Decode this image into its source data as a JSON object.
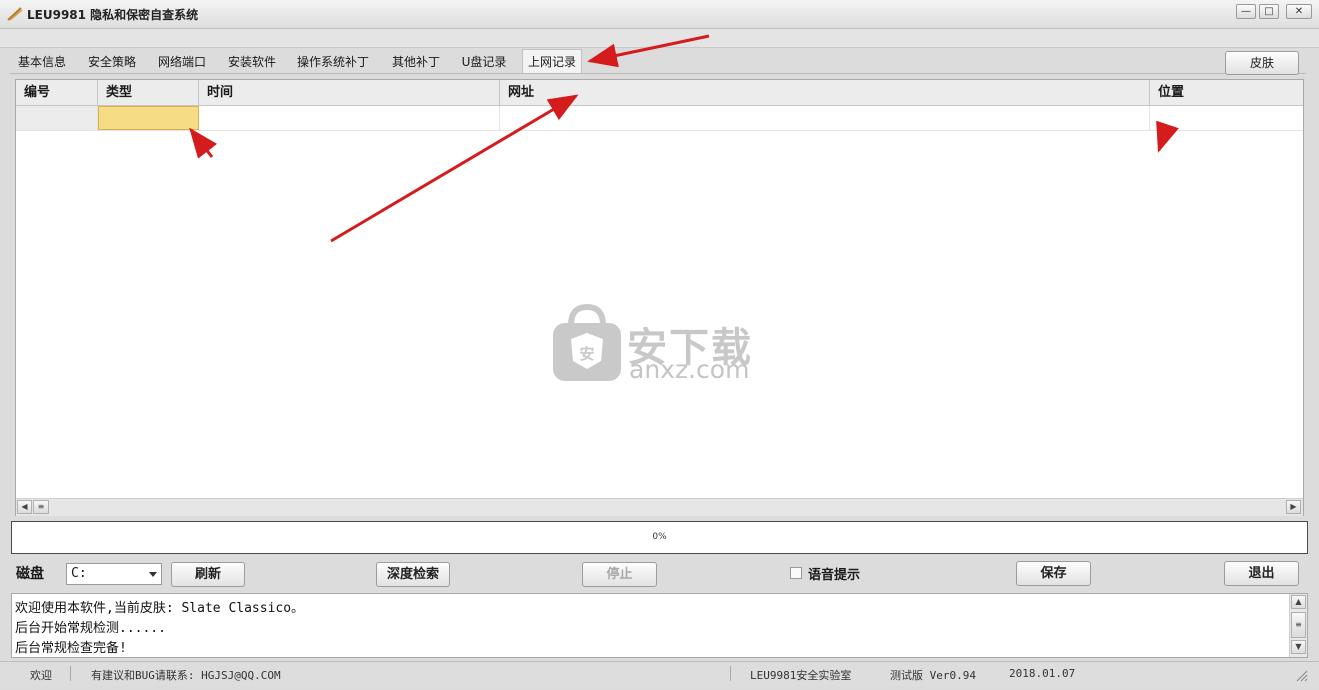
{
  "window": {
    "title": "LEU9981 隐私和保密自查系统",
    "controls": [
      "minimize",
      "maximize",
      "close"
    ]
  },
  "tabs": [
    {
      "label": "基本信息",
      "active": false
    },
    {
      "label": "安全策略",
      "active": false
    },
    {
      "label": "网络端口",
      "active": false
    },
    {
      "label": "安装软件",
      "active": false
    },
    {
      "label": "操作系统补丁",
      "active": false
    },
    {
      "label": "其他补丁",
      "active": false
    },
    {
      "label": "U盘记录",
      "active": false
    },
    {
      "label": "上网记录",
      "active": true
    }
  ],
  "skin_button": "皮肤",
  "grid": {
    "columns": [
      "编号",
      "类型",
      "时间",
      "网址",
      "位置"
    ],
    "rows": [
      [
        "",
        "",
        "",
        "",
        ""
      ]
    ]
  },
  "watermark": {
    "cn": "安下载",
    "en": "anxz.com",
    "shield": "安"
  },
  "progress": {
    "text": "0%",
    "value": 0
  },
  "controls": {
    "disk_label": "磁盘",
    "disk_value": "C:",
    "refresh": "刷新",
    "deep_search": "深度检索",
    "stop": "停止",
    "voice_prompt": "语音提示",
    "voice_checked": false,
    "save": "保存",
    "exit": "退出"
  },
  "log": [
    "欢迎使用本软件,当前皮肤: Slate Classico。",
    "后台开始常规检测......",
    "后台常规检查完备!"
  ],
  "statusbar": {
    "welcome": "欢迎",
    "contact": "有建议和BUG请联系: HGJSJ@QQ.COM",
    "lab": "LEU9981安全实验室",
    "version": "测试版 Ver0.94",
    "date": "2018.01.07"
  },
  "colors": {
    "selected_cell": "#f6dc84",
    "annotation_arrow": "#d41c1c"
  }
}
